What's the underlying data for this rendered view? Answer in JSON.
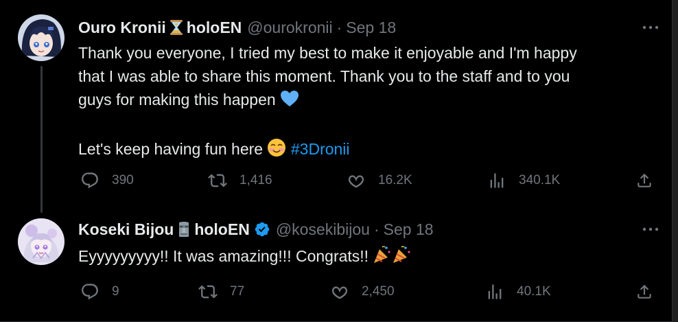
{
  "tweets": [
    {
      "display_name_1": "Ouro Kronii",
      "display_name_2": "holoEN",
      "name_emoji": "hourglass-emoji",
      "handle": "@ourokronii",
      "separator": "·",
      "date": "Sep 18",
      "body_line1": "Thank you everyone, I tried my best to make it enjoyable and I'm happy",
      "body_line2": "that I was able to share this moment. Thank you to the staff and to you",
      "body_line3": "guys for making this happen",
      "body_line4": "Let's keep having fun here",
      "hashtag": "#3Dronii",
      "replies": "390",
      "reposts": "1,416",
      "likes": "16.2K",
      "views": "340.1K"
    },
    {
      "display_name_1": "Koseki Bijou",
      "display_name_2": "holoEN",
      "name_emoji": "moai-emoji",
      "verified": true,
      "handle": "@kosekibijou",
      "separator": "·",
      "date": "Sep 18",
      "body_line1": "Eyyyyyyyyy!! It was amazing!!! Congrats!!",
      "replies": "9",
      "reposts": "77",
      "likes": "2,450",
      "views": "40.1K"
    }
  ],
  "colors": {
    "background": "#000000",
    "text": "#e7e9ea",
    "muted": "#71767b",
    "link": "#1d9bf0",
    "verified": "#1d9bf0",
    "heart": "#5fb0f5"
  }
}
